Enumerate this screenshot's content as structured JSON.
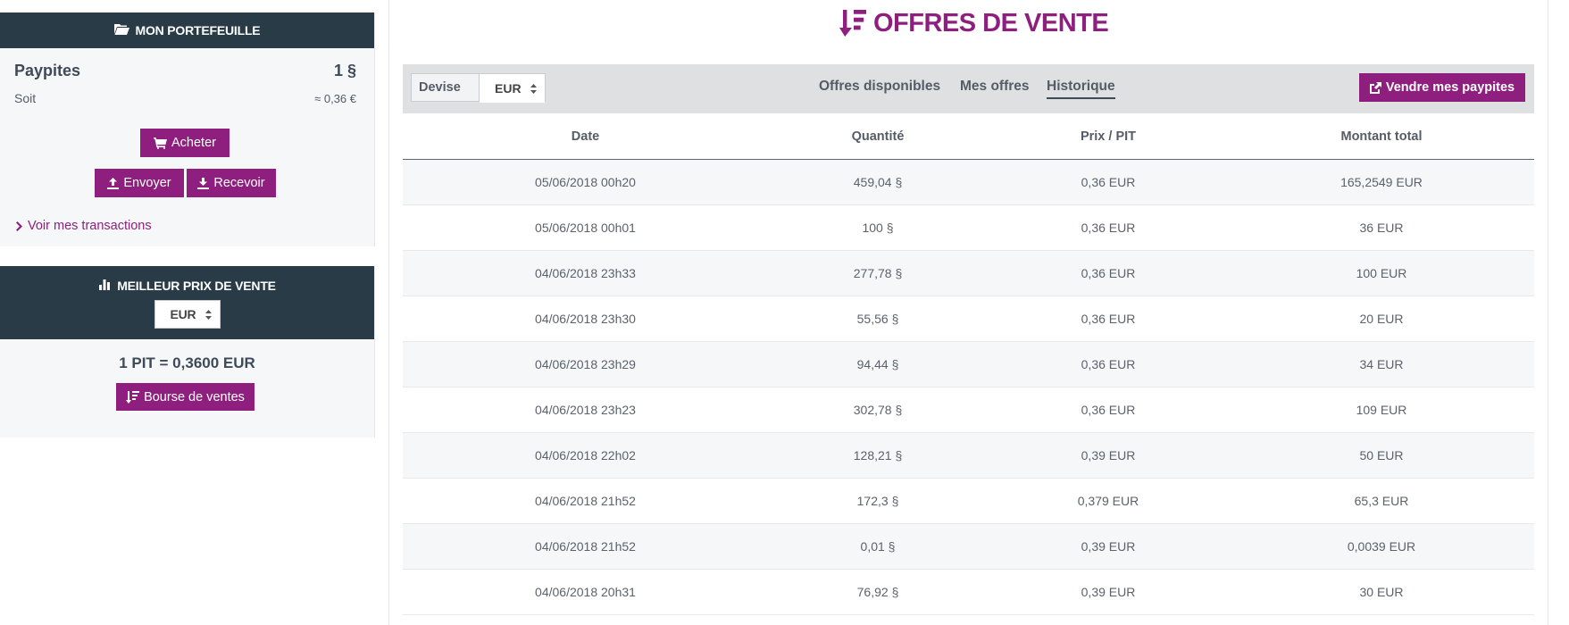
{
  "wallet": {
    "title": "MON PORTEFEUILLE",
    "currency_name": "Paypites",
    "balance": "1 §",
    "soit_label": "Soit",
    "soit_value": "≈ 0,36 €",
    "buy_label": "Acheter",
    "send_label": "Envoyer",
    "receive_label": "Recevoir",
    "transactions_link": "Voir mes transactions"
  },
  "best_price": {
    "title": "MEILLEUR PRIX DE VENTE",
    "currency": "EUR",
    "rate": "1 PIT = 0,3600 EUR",
    "bourse_label": "Bourse de ventes"
  },
  "main": {
    "title": "OFFRES DE VENTE",
    "devise_label": "Devise",
    "devise_value": "EUR",
    "tabs": [
      "Offres disponibles",
      "Mes offres",
      "Historique"
    ],
    "active_tab": "Historique",
    "sell_button": "Vendre mes paypites"
  },
  "table": {
    "headers": [
      "Date",
      "Quantité",
      "Prix / PIT",
      "Montant total"
    ],
    "rows": [
      [
        "05/06/2018 00h20",
        "459,04 §",
        "0,36 EUR",
        "165,2549 EUR"
      ],
      [
        "05/06/2018 00h01",
        "100 §",
        "0,36 EUR",
        "36 EUR"
      ],
      [
        "04/06/2018 23h33",
        "277,78 §",
        "0,36 EUR",
        "100 EUR"
      ],
      [
        "04/06/2018 23h30",
        "55,56 §",
        "0,36 EUR",
        "20 EUR"
      ],
      [
        "04/06/2018 23h29",
        "94,44 §",
        "0,36 EUR",
        "34 EUR"
      ],
      [
        "04/06/2018 23h23",
        "302,78 §",
        "0,36 EUR",
        "109 EUR"
      ],
      [
        "04/06/2018 22h02",
        "128,21 §",
        "0,39 EUR",
        "50 EUR"
      ],
      [
        "04/06/2018 21h52",
        "172,3 §",
        "0,379 EUR",
        "65,3 EUR"
      ],
      [
        "04/06/2018 21h52",
        "0,01 §",
        "0,39 EUR",
        "0,0039 EUR"
      ],
      [
        "04/06/2018 20h31",
        "76,92 §",
        "0,39 EUR",
        "30 EUR"
      ]
    ]
  },
  "colors": {
    "accent": "#8e1f7e",
    "header_dark": "#283b47",
    "toolbar": "#dfe0e2"
  }
}
